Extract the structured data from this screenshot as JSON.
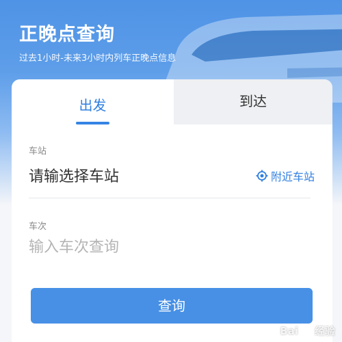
{
  "header": {
    "title": "正晚点查询",
    "subtitle": "过去1小时-未来3小时内列车正晚点信息"
  },
  "tabs": {
    "depart_label": "出发",
    "arrive_label": "到达"
  },
  "station": {
    "label": "车站",
    "value": "请输选择车站",
    "nearby_label": "附近车站",
    "nearby_icon": "location-target-icon"
  },
  "train_no": {
    "label": "车次",
    "placeholder": "输入车次查询"
  },
  "query_button_label": "查询",
  "watermark": {
    "text_left": "Bai",
    "text_right": "经验",
    "icon": "baidu-paw-icon"
  },
  "colors": {
    "accent": "#2f7fe0",
    "button": "#4790e6",
    "banner": "#4f93e6"
  }
}
